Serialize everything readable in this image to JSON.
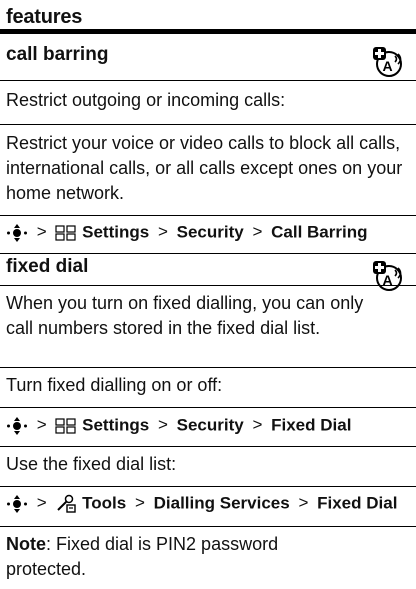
{
  "header": {
    "title": "features"
  },
  "sections": [
    {
      "title": "call barring",
      "icon": "network-feature-icon",
      "intro": "Restrict outgoing or incoming calls:",
      "desc": "Restrict your voice or video calls to block all calls, international calls, or all calls except ones on your home network.",
      "path": {
        "icon": "nav-key-icon",
        "sep": ">",
        "items": [
          {
            "icon": "settings-icon",
            "label": "Settings"
          },
          {
            "label": "Security"
          },
          {
            "label": "Call Barring"
          }
        ]
      }
    },
    {
      "title": "fixed dial",
      "icon": "network-feature-icon",
      "para1": "When you turn on fixed dialling, you can only call numbers stored in the fixed dial list.",
      "para2": "Turn fixed dialling on or off:",
      "path1": {
        "icon": "nav-key-icon",
        "sep": ">",
        "items": [
          {
            "icon": "settings-icon",
            "label": "Settings"
          },
          {
            "label": "Security"
          },
          {
            "label": "Fixed Dial"
          }
        ]
      },
      "para3": "Use the fixed dial list:",
      "path2": {
        "icon": "nav-key-icon",
        "sep": ">",
        "items": [
          {
            "icon": "tools-icon",
            "label": "Tools"
          },
          {
            "label": "Dialling Services"
          },
          {
            "label": "Fixed Dial"
          }
        ]
      },
      "note_label": "Note",
      "note_text": ": Fixed dial is PIN2 password protected."
    }
  ]
}
